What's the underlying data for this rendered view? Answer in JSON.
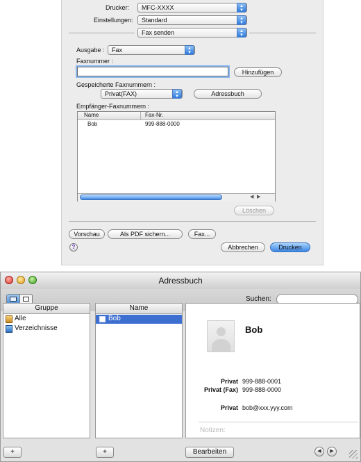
{
  "print_dialog": {
    "printer_label": "Drucker:",
    "printer_value": "MFC-XXXX",
    "settings_label": "Einstellungen:",
    "settings_value": "Standard",
    "panel_value": "Fax senden",
    "output_label": "Ausgabe :",
    "output_value": "Fax",
    "fax_number_label": "Faxnummer :",
    "fax_number_value": "",
    "add_button": "Hinzufügen",
    "saved_numbers_label": "Gespeicherte Faxnummern :",
    "saved_numbers_value": "Privat(FAX)",
    "address_book_button": "Adressbuch",
    "recipients_label": "Empfänger-Faxnummern :",
    "recipients_columns": [
      "Name",
      "Fax-Nr."
    ],
    "recipients_rows": [
      {
        "name": "Bob",
        "fax": "999-888-0000"
      }
    ],
    "delete_button": "Löschen",
    "preview_button": "Vorschau",
    "save_pdf_button": "Als PDF sichern...",
    "fax_button": "Fax...",
    "help_icon_text": "?",
    "cancel_button": "Abbrechen",
    "print_button": "Drucken"
  },
  "address_book": {
    "title": "Adressbuch",
    "search_label": "Suchen:",
    "search_value": "",
    "group_header": "Gruppe",
    "name_header": "Name",
    "groups": [
      "Alle",
      "Verzeichnisse"
    ],
    "names": [
      "Bob"
    ],
    "card": {
      "name": "Bob",
      "fields": [
        {
          "label": "Privat",
          "value": "999-888-0001"
        },
        {
          "label": "Privat (Fax)",
          "value": "999-888-0000"
        },
        {
          "label": "Privat",
          "value": "bob@xxx.yyy.com"
        }
      ],
      "notes_label": "Notizen:"
    },
    "add_group_glyph": "+",
    "add_name_glyph": "+",
    "edit_button": "Bearbeiten"
  }
}
